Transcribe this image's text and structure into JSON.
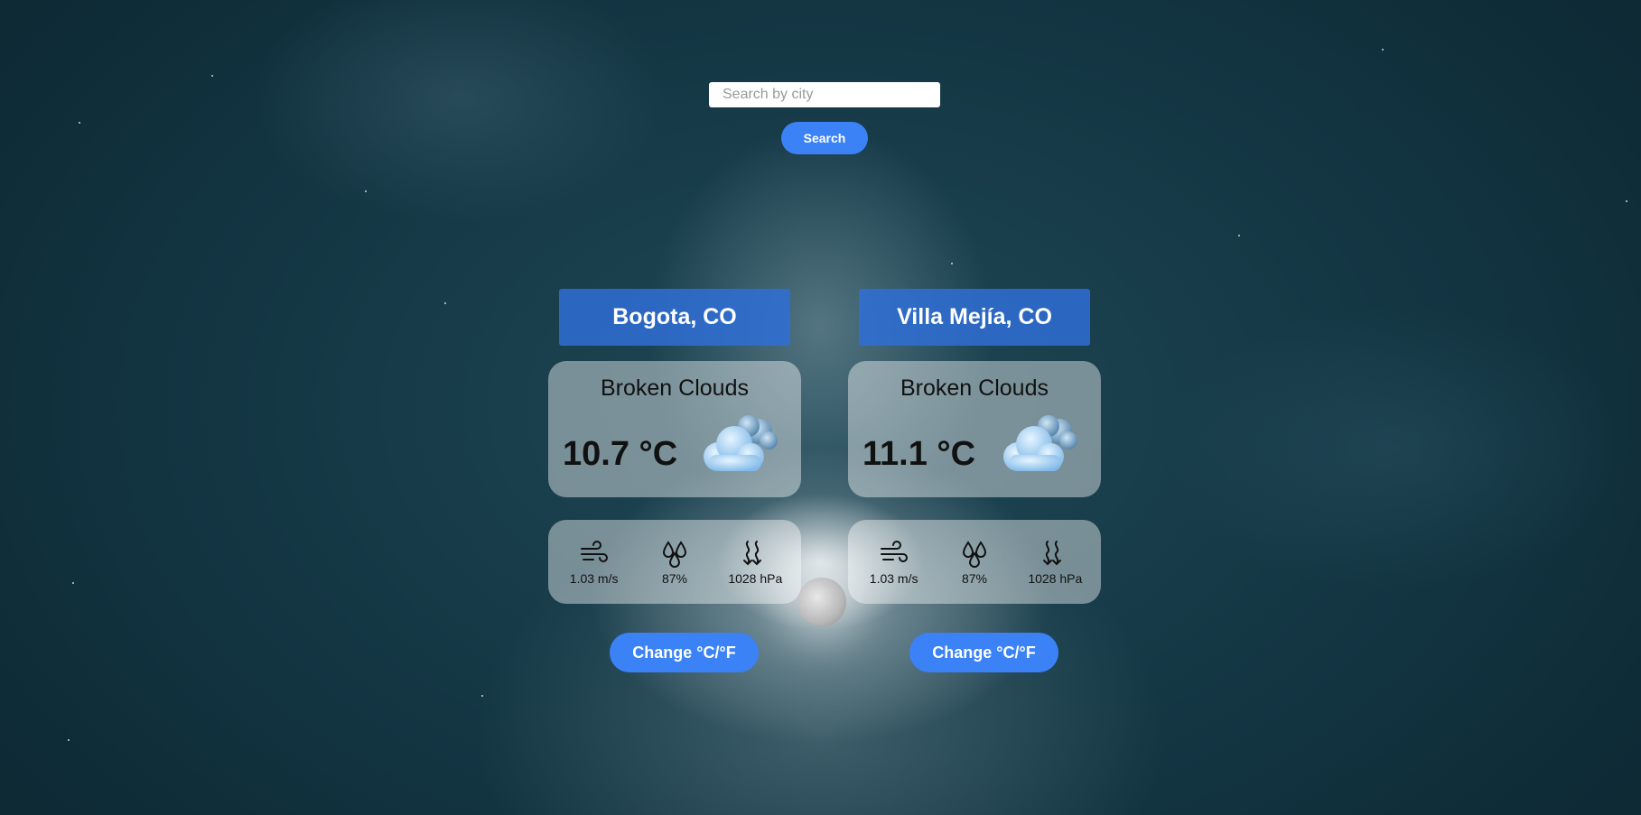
{
  "search": {
    "placeholder": "Search by city",
    "value": "",
    "button_label": "Search"
  },
  "cities": [
    {
      "name": "Bogota, CO",
      "condition": "Broken Clouds",
      "temperature": "10.7 °C",
      "weather_icon": "broken-clouds-icon",
      "wind": "1.03 m/s",
      "humidity": "87%",
      "pressure": "1028 hPa",
      "toggle_label": "Change °C/°F"
    },
    {
      "name": "Villa Mejía, CO",
      "condition": "Broken Clouds",
      "temperature": "11.1 °C",
      "weather_icon": "broken-clouds-icon",
      "wind": "1.03 m/s",
      "humidity": "87%",
      "pressure": "1028 hPa",
      "toggle_label": "Change °C/°F"
    }
  ],
  "colors": {
    "accent": "#3b82f6",
    "header": "#2f6ed6",
    "panel": "rgba(255,255,255,0.42)"
  }
}
